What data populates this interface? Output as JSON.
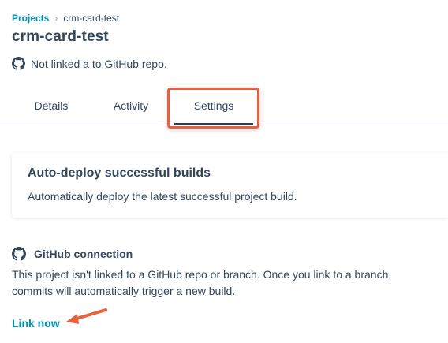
{
  "breadcrumb": {
    "parent": "Projects",
    "separator": "›",
    "current": "crm-card-test"
  },
  "page": {
    "title": "crm-card-test",
    "repo_status": "Not linked a to GitHub repo."
  },
  "tabs": [
    {
      "label": "Details",
      "active": false
    },
    {
      "label": "Activity",
      "active": false
    },
    {
      "label": "Settings",
      "active": true
    }
  ],
  "auto_deploy": {
    "title": "Auto-deploy successful builds",
    "description": "Automatically deploy the latest successful project build."
  },
  "github": {
    "title": "GitHub connection",
    "description": "This project isn't linked to a GitHub repo or branch. Once you link to a branch, commits will automatically trigger a new build.",
    "link_label": "Link now"
  },
  "colors": {
    "accent": "#0091ae",
    "text": "#33475b",
    "highlight": "#e8603c",
    "active_tab": "#2d3e50"
  },
  "icons": {
    "repo_status": "github-icon",
    "section": "github-icon",
    "annotation": "arrow-pointer"
  }
}
